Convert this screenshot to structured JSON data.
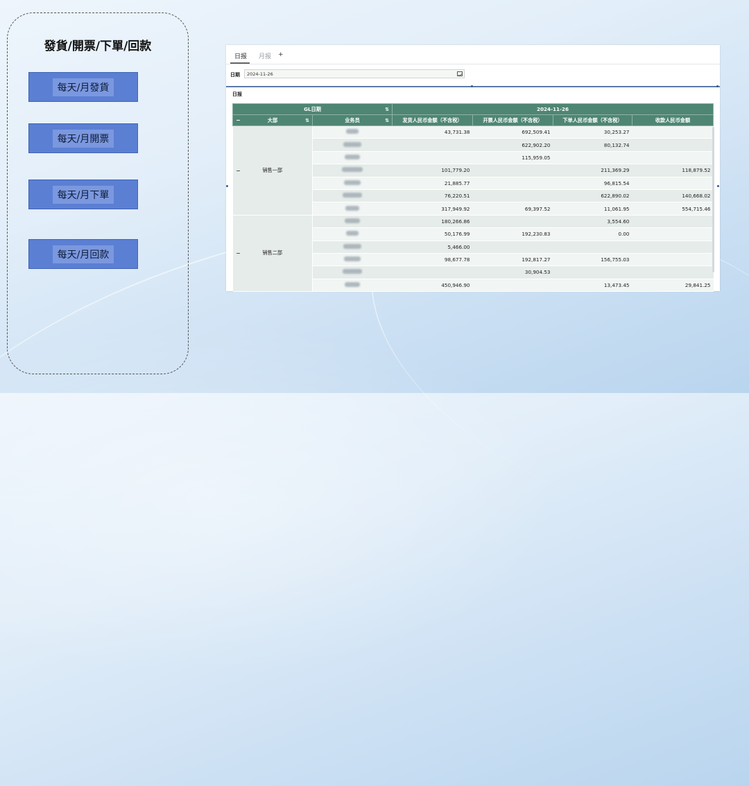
{
  "left_panel": {
    "title": "發貨/開票/下單/回款",
    "buttons": [
      "每天/月發貨",
      "每天/月開票",
      "每天/月下單",
      "每天/月回款"
    ]
  },
  "report": {
    "tabs": {
      "daily": "日报",
      "monthly": "月报",
      "add": "+"
    },
    "filter": {
      "label": "日期",
      "value": "2024-11-26",
      "icon": "calendar-icon"
    },
    "section_label": "日报",
    "headers": {
      "gl_date": "GL日期",
      "date": "2024-11-26",
      "dept": "大部",
      "salesperson": "业务员",
      "cols": [
        "发货人民币金额（不含税）",
        "开票人民币金额（不含税）",
        "下单人民币金额（不含税）",
        "收款人民币金额"
      ]
    },
    "groups": [
      {
        "name": "销售一部",
        "rows": [
          [
            "43,731.38",
            "692,509.41",
            "30,253.27",
            ""
          ],
          [
            "",
            "622,902.20",
            "80,132.74",
            ""
          ],
          [
            "",
            "115,959.05",
            "",
            ""
          ],
          [
            "101,779.20",
            "",
            "211,369.29",
            "118,879.52"
          ],
          [
            "21,885.77",
            "",
            "96,815.54",
            ""
          ],
          [
            "76,220.51",
            "",
            "622,890.02",
            "140,668.02"
          ],
          [
            "317,949.92",
            "69,397.52",
            "11,061.95",
            "554,715.46"
          ]
        ]
      },
      {
        "name": "销售二部",
        "rows": [
          [
            "180,266.86",
            "",
            "3,554.60",
            ""
          ],
          [
            "50,176.99",
            "192,230.83",
            "0.00",
            ""
          ],
          [
            "5,466.00",
            "",
            "",
            ""
          ],
          [
            "98,677.78",
            "192,817.27",
            "156,755.03",
            ""
          ],
          [
            "",
            "30,904.53",
            "",
            ""
          ],
          [
            "450,946.90",
            "",
            "13,473.45",
            "29,841.25"
          ]
        ]
      }
    ]
  }
}
